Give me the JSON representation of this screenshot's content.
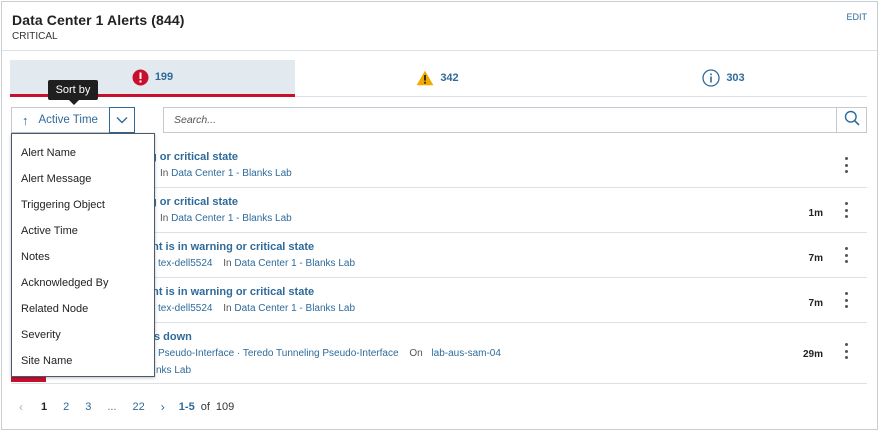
{
  "header": {
    "title": "Data Center 1 Alerts (844)",
    "subtitle": "CRITICAL",
    "edit_label": "EDIT"
  },
  "tabs": [
    {
      "icon": "critical-icon",
      "count": "199",
      "color": "#c8102e"
    },
    {
      "icon": "warning-icon",
      "count": "342",
      "color": "#f2a900"
    },
    {
      "icon": "info-icon",
      "count": "303",
      "color": "#2e6a9a"
    }
  ],
  "sort": {
    "label": "Active Time",
    "tooltip": "Sort by",
    "arrow_icon": "arrow-up-icon",
    "toggle_icon": "chevron-down-icon"
  },
  "search": {
    "placeholder": "Search..."
  },
  "sort_options": [
    "Alert Name",
    "Alert Message",
    "Triggering Object",
    "Active Time",
    "Notes",
    "Acknowledged By",
    "Related Node",
    "Severity",
    "Site Name"
  ],
  "alerts": [
    {
      "title_visible": "g or critical state",
      "meta_prefix": "In",
      "location": "Data Center 1 - Blanks Lab",
      "age": ""
    },
    {
      "title_visible": "g or critical state",
      "meta_prefix": "In",
      "location": "Data Center 1 - Blanks Lab",
      "age": "1m"
    },
    {
      "title_visible": "ent is in warning or critical state",
      "object": "tex-dell5524",
      "meta_prefix": "In",
      "location": "Data Center 1 - Blanks Lab",
      "age": "7m"
    },
    {
      "title_visible": "ent is in warning or critical state",
      "object": "tex-dell5524",
      "meta_prefix": "In",
      "location": "Data Center 1 - Blanks Lab",
      "age": "7m"
    },
    {
      "title_visible": "s down",
      "object": "Pseudo-Interface · Teredo Tunneling Pseudo-Interface",
      "on_label": "On",
      "node": "lab-aus-sam-04",
      "location_partial": "nks Lab",
      "age": "29m"
    }
  ],
  "pagination": {
    "pages": [
      "1",
      "2",
      "3",
      "...",
      "22"
    ],
    "current": "1",
    "range": "1-5",
    "of_label": "of",
    "total": "109"
  }
}
